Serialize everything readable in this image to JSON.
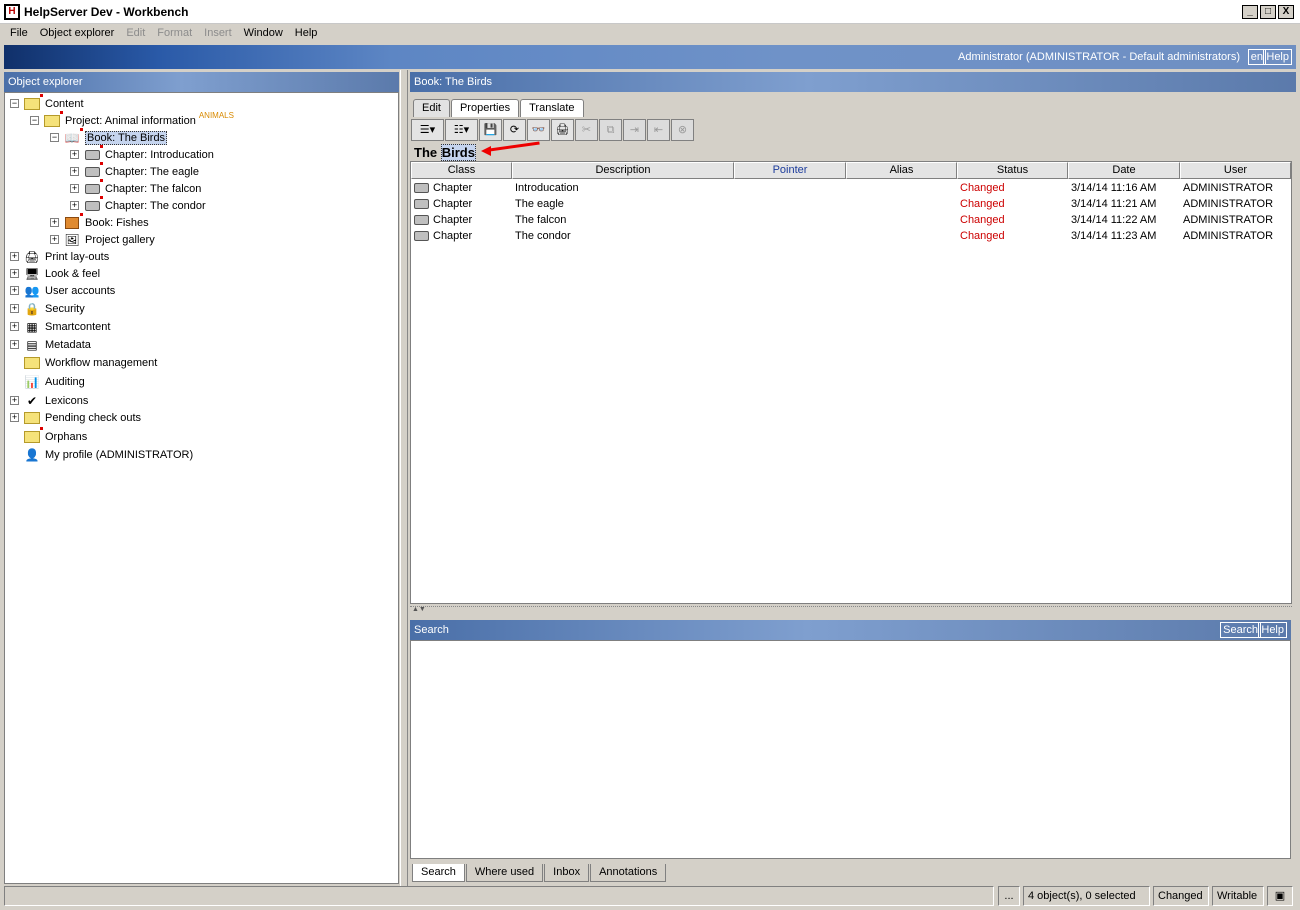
{
  "window": {
    "title": "HelpServer Dev - Workbench",
    "controls": [
      "_",
      "□",
      "X"
    ]
  },
  "menu": [
    "File",
    "Object explorer",
    "Edit",
    "Format",
    "Insert",
    "Window",
    "Help"
  ],
  "banner": {
    "user": "Administrator (ADMINISTRATOR - Default administrators)",
    "lang_button": "en",
    "help_button": "Help"
  },
  "explorer": {
    "title": "Object explorer",
    "items": {
      "content": "Content",
      "project": "Project: Animal information",
      "project_badge": "ANIMALS",
      "book_birds": "Book: The Birds",
      "ch_intro": "Chapter: Introducation",
      "ch_eagle": "Chapter: The eagle",
      "ch_falcon": "Chapter: The falcon",
      "ch_condor": "Chapter: The condor",
      "book_fishes": "Book: Fishes",
      "gallery": "Project gallery",
      "print": "Print lay-outs",
      "look": "Look & feel",
      "users": "User accounts",
      "security": "Security",
      "smart": "Smartcontent",
      "meta": "Metadata",
      "workflow": "Workflow management",
      "auditing": "Auditing",
      "lexicons": "Lexicons",
      "pending": "Pending check outs",
      "orphans": "Orphans",
      "profile": "My profile (ADMINISTRATOR)"
    }
  },
  "editor": {
    "header": "Book: The Birds",
    "tabs": [
      "Edit",
      "Properties",
      "Translate"
    ],
    "doc_title_plain": "The ",
    "doc_title_highlight": "Birds",
    "columns": [
      "Class",
      "Description",
      "Pointer",
      "Alias",
      "Status",
      "Date",
      "User"
    ],
    "rows": [
      {
        "class": "Chapter",
        "description": "Introducation",
        "pointer": "",
        "alias": "",
        "status": "Changed",
        "date": "3/14/14 11:16 AM",
        "user": "ADMINISTRATOR"
      },
      {
        "class": "Chapter",
        "description": "The eagle",
        "pointer": "",
        "alias": "",
        "status": "Changed",
        "date": "3/14/14 11:21 AM",
        "user": "ADMINISTRATOR"
      },
      {
        "class": "Chapter",
        "description": "The falcon",
        "pointer": "",
        "alias": "",
        "status": "Changed",
        "date": "3/14/14 11:22 AM",
        "user": "ADMINISTRATOR"
      },
      {
        "class": "Chapter",
        "description": "The condor",
        "pointer": "",
        "alias": "",
        "status": "Changed",
        "date": "3/14/14 11:23 AM",
        "user": "ADMINISTRATOR"
      }
    ]
  },
  "search": {
    "title": "Search",
    "search_button": "Search",
    "help_button": "Help",
    "tabs": [
      "Search",
      "Where used",
      "Inbox",
      "Annotations"
    ]
  },
  "status": {
    "ellipsis": "...",
    "selection": "4 object(s), 0 selected",
    "state": "Changed",
    "mode": "Writable"
  }
}
